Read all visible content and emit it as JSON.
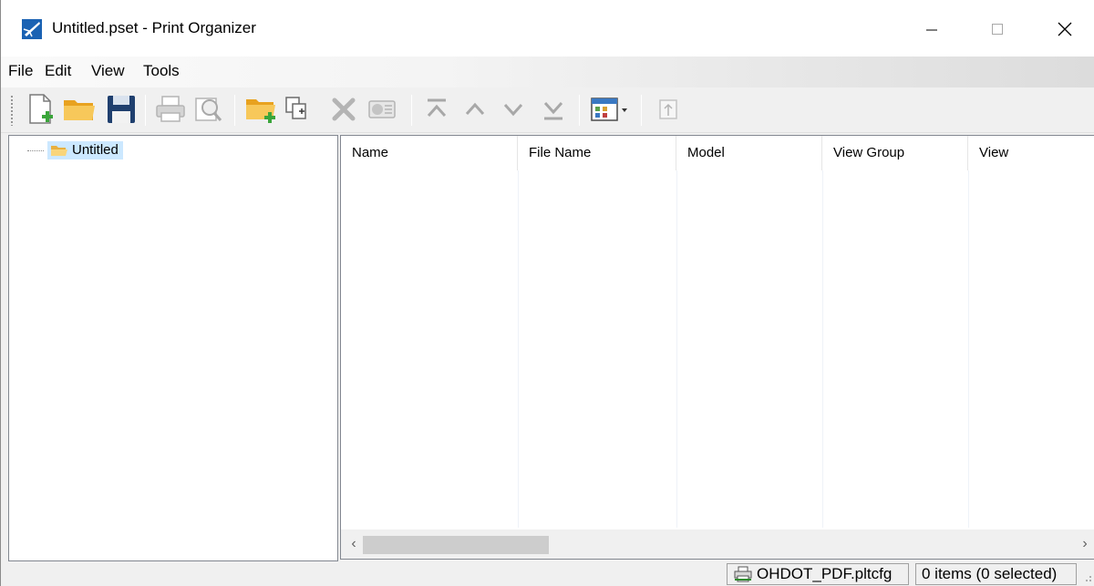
{
  "window": {
    "title": "Untitled.pset - Print Organizer",
    "icon": "print-organizer-app-icon",
    "controls": [
      "minimize-icon",
      "maximize-icon",
      "close-icon"
    ]
  },
  "menu": {
    "items": [
      {
        "label": "File"
      },
      {
        "label": "Edit"
      },
      {
        "label": "View"
      },
      {
        "label": "Tools"
      }
    ]
  },
  "toolbar": {
    "buttons": [
      {
        "name": "new-set-button",
        "icon": "new-file-icon"
      },
      {
        "name": "open-button",
        "icon": "open-folder-icon"
      },
      {
        "name": "save-button",
        "icon": "save-disk-icon"
      },
      {
        "name": "print-button",
        "icon": "printer-icon",
        "disabled": true
      },
      {
        "name": "preview-button",
        "icon": "preview-icon",
        "disabled": true
      },
      {
        "name": "add-folder-button",
        "icon": "add-folder-icon"
      },
      {
        "name": "add-files-button",
        "icon": "add-files-icon"
      },
      {
        "name": "delete-button",
        "icon": "delete-x-icon",
        "disabled": true
      },
      {
        "name": "properties-button",
        "icon": "properties-icon",
        "disabled": true
      },
      {
        "name": "move-top-button",
        "icon": "move-top-icon",
        "disabled": true
      },
      {
        "name": "move-up-button",
        "icon": "move-up-icon",
        "disabled": true
      },
      {
        "name": "move-down-button",
        "icon": "move-down-icon",
        "disabled": true
      },
      {
        "name": "move-bottom-button",
        "icon": "move-bottom-icon",
        "disabled": true
      },
      {
        "name": "display-mode-button",
        "icon": "display-mode-icon"
      },
      {
        "name": "promote-button",
        "icon": "promote-icon",
        "disabled": true
      }
    ]
  },
  "tree": {
    "root": {
      "label": "Untitled",
      "icon": "folder-icon",
      "selected": true
    }
  },
  "list": {
    "columns": [
      {
        "label": "Name"
      },
      {
        "label": "File Name"
      },
      {
        "label": "Model"
      },
      {
        "label": "View Group"
      },
      {
        "label": "View"
      }
    ],
    "rows": [],
    "scrollbar": {
      "left_arrow": "‹",
      "right_arrow": "›"
    }
  },
  "status": {
    "printer_config": "OHDOT_PDF.pltcfg",
    "printer_icon": "printer-icon",
    "item_count": "0 items (0 selected)"
  },
  "colors": {
    "selection": "#cce8ff",
    "folder": "#f7c85a",
    "save_blue": "#1f3f6e",
    "disabled": "#b4b4b4"
  }
}
